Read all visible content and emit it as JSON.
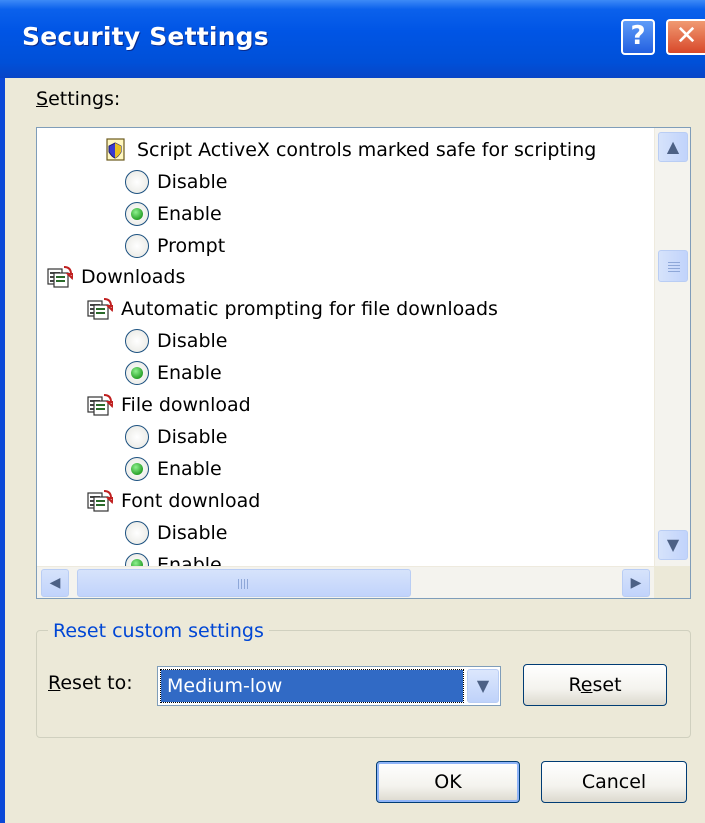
{
  "window": {
    "title": "Security Settings",
    "help_button": "?",
    "close_button": "✕"
  },
  "settings": {
    "label_underlined": "S",
    "label_rest": "ettings:",
    "items": [
      {
        "kind": "node",
        "label": "Script ActiveX controls marked safe for scripting",
        "icon": "script-icon"
      },
      {
        "kind": "radio",
        "label": "Disable",
        "checked": false
      },
      {
        "kind": "radio",
        "label": "Enable",
        "checked": true
      },
      {
        "kind": "radio",
        "label": "Prompt",
        "checked": false
      },
      {
        "kind": "node",
        "label": "Downloads",
        "icon": "downloads-icon"
      },
      {
        "kind": "node",
        "label": "Automatic prompting for file downloads",
        "icon": "downloads-icon"
      },
      {
        "kind": "radio",
        "label": "Disable",
        "checked": false
      },
      {
        "kind": "radio",
        "label": "Enable",
        "checked": true
      },
      {
        "kind": "node",
        "label": "File download",
        "icon": "downloads-icon"
      },
      {
        "kind": "radio",
        "label": "Disable",
        "checked": false
      },
      {
        "kind": "radio",
        "label": "Enable",
        "checked": true
      },
      {
        "kind": "node",
        "label": "Font download",
        "icon": "downloads-icon"
      },
      {
        "kind": "radio",
        "label": "Disable",
        "checked": false
      },
      {
        "kind": "radio",
        "label": "Enable",
        "checked": true
      }
    ]
  },
  "reset_group": {
    "legend": "Reset custom settings",
    "reset_to_underlined": "R",
    "reset_to_rest": "eset to:",
    "selected_level": "Medium-low",
    "reset_button_pre": "R",
    "reset_button_underlined": "e",
    "reset_button_post": "set"
  },
  "footer": {
    "ok_label": "OK",
    "cancel_label": "Cancel"
  },
  "colors": {
    "titlebar": "#0055e5",
    "dialog_bg": "#ece9d8",
    "group_legend": "#0046d5",
    "selection": "#316ac5"
  }
}
